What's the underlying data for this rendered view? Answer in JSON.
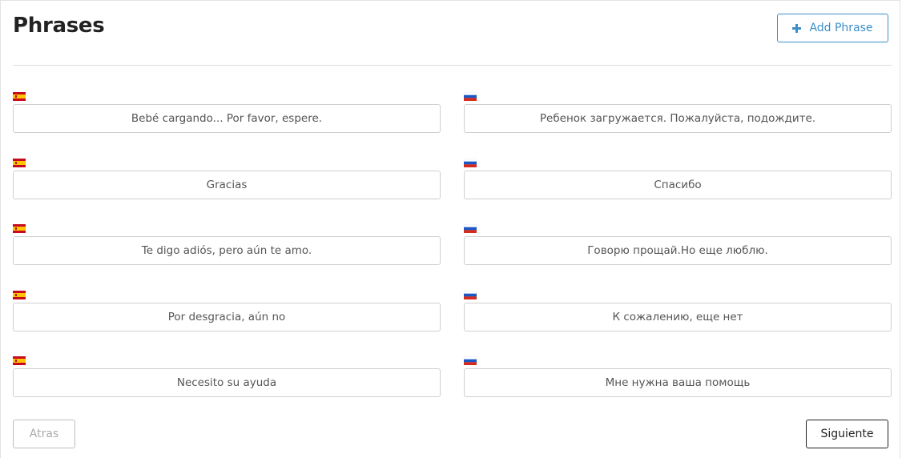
{
  "header": {
    "title": "Phrases",
    "add_button_label": "Add Phrase"
  },
  "phrases": [
    {
      "source": {
        "flag": "spain-flag-icon",
        "text": "Bebé cargando... Por favor, espere."
      },
      "target": {
        "flag": "russia-flag-icon",
        "text": "Ребенок загружается. Пожалуйста, подождите."
      }
    },
    {
      "source": {
        "flag": "spain-flag-icon",
        "text": "Gracias"
      },
      "target": {
        "flag": "russia-flag-icon",
        "text": "Спасибо"
      }
    },
    {
      "source": {
        "flag": "spain-flag-icon",
        "text": "Te digo adiós, pero aún te amo."
      },
      "target": {
        "flag": "russia-flag-icon",
        "text": "Говорю прощай.Но еще люблю."
      }
    },
    {
      "source": {
        "flag": "spain-flag-icon",
        "text": "Por desgracia, aún no"
      },
      "target": {
        "flag": "russia-flag-icon",
        "text": "К сожалению, еще нет"
      }
    },
    {
      "source": {
        "flag": "spain-flag-icon",
        "text": "Necesito su ayuda"
      },
      "target": {
        "flag": "russia-flag-icon",
        "text": "Мне нужна ваша помощь"
      }
    }
  ],
  "footer": {
    "back_label": "Atras",
    "next_label": "Siguiente"
  },
  "colors": {
    "accent": "#3d8fc8",
    "border": "#cfcfcf",
    "disabled_text": "#aaaaaa"
  }
}
